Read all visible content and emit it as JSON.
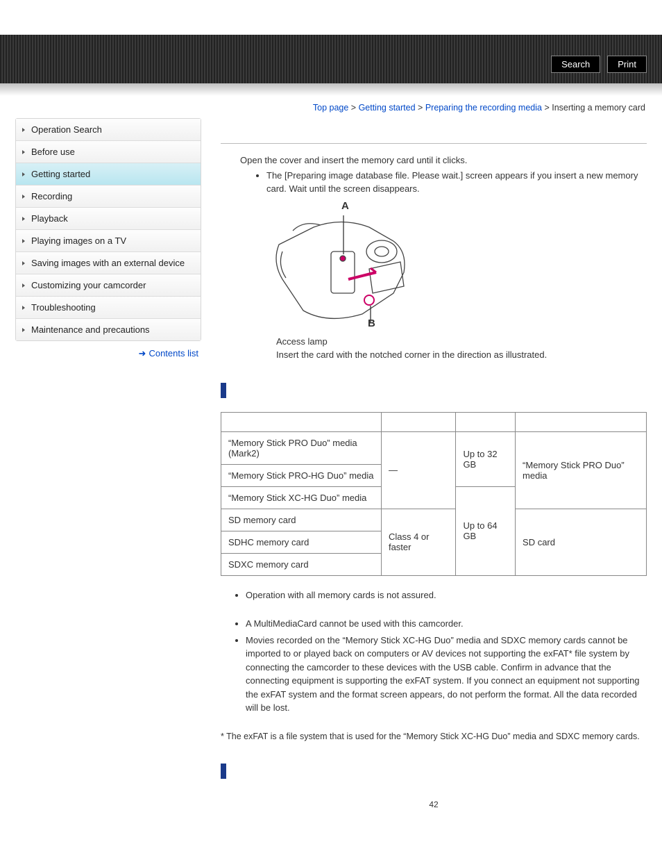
{
  "header": {
    "search": "Search",
    "print": "Print"
  },
  "breadcrumb": {
    "top": "Top page",
    "l1": "Getting started",
    "l2": "Preparing the recording media",
    "current": "Inserting a memory card"
  },
  "sidebar": {
    "items": [
      {
        "label": "Operation Search"
      },
      {
        "label": "Before use"
      },
      {
        "label": "Getting started"
      },
      {
        "label": "Recording"
      },
      {
        "label": "Playback"
      },
      {
        "label": "Playing images on a TV"
      },
      {
        "label": "Saving images with an external device"
      },
      {
        "label": "Customizing your camcorder"
      },
      {
        "label": "Troubleshooting"
      },
      {
        "label": "Maintenance and precautions"
      }
    ],
    "contents_link": "Contents list"
  },
  "content": {
    "intro": "Open the cover and insert the memory card until it clicks.",
    "intro_bullet": "The [Preparing image database file. Please wait.] screen appears if you insert a new memory card. Wait until the screen disappears.",
    "diagram_label_a": "A",
    "diagram_label_b": "B",
    "caption_a": "Access lamp",
    "caption_b": "Insert the card with the notched corner in the direction as illustrated.",
    "table": {
      "rows": [
        {
          "name": "“Memory Stick PRO Duo” media (Mark2)"
        },
        {
          "name": "“Memory Stick PRO-HG Duo” media"
        },
        {
          "name": "“Memory Stick XC-HG Duo” media"
        },
        {
          "name": "SD memory card"
        },
        {
          "name": "SDHC memory card"
        },
        {
          "name": "SDXC memory card"
        }
      ],
      "speed_ms": "—",
      "speed_sd": "Class 4 or faster",
      "cap_32": "Up to 32 GB",
      "cap_64": "Up to 64 GB",
      "desc_ms": "“Memory Stick PRO Duo” media",
      "desc_sd": "SD card"
    },
    "note1": "Operation with all memory cards is not assured.",
    "note2": "A MultiMediaCard cannot be used with this camcorder.",
    "note3": "Movies recorded on the “Memory Stick XC-HG Duo” media and SDXC memory cards cannot be imported to or played back on computers or AV devices not supporting the exFAT* file system by connecting the camcorder to these devices with the USB cable. Confirm in advance that the connecting equipment is supporting the exFAT system. If you connect an equipment not supporting the exFAT system and the format screen appears, do not perform the format. All the data recorded will be lost.",
    "footnote": "* The exFAT is a file system that is used for the “Memory Stick XC-HG Duo” media and SDXC memory cards."
  },
  "page_number": "42"
}
